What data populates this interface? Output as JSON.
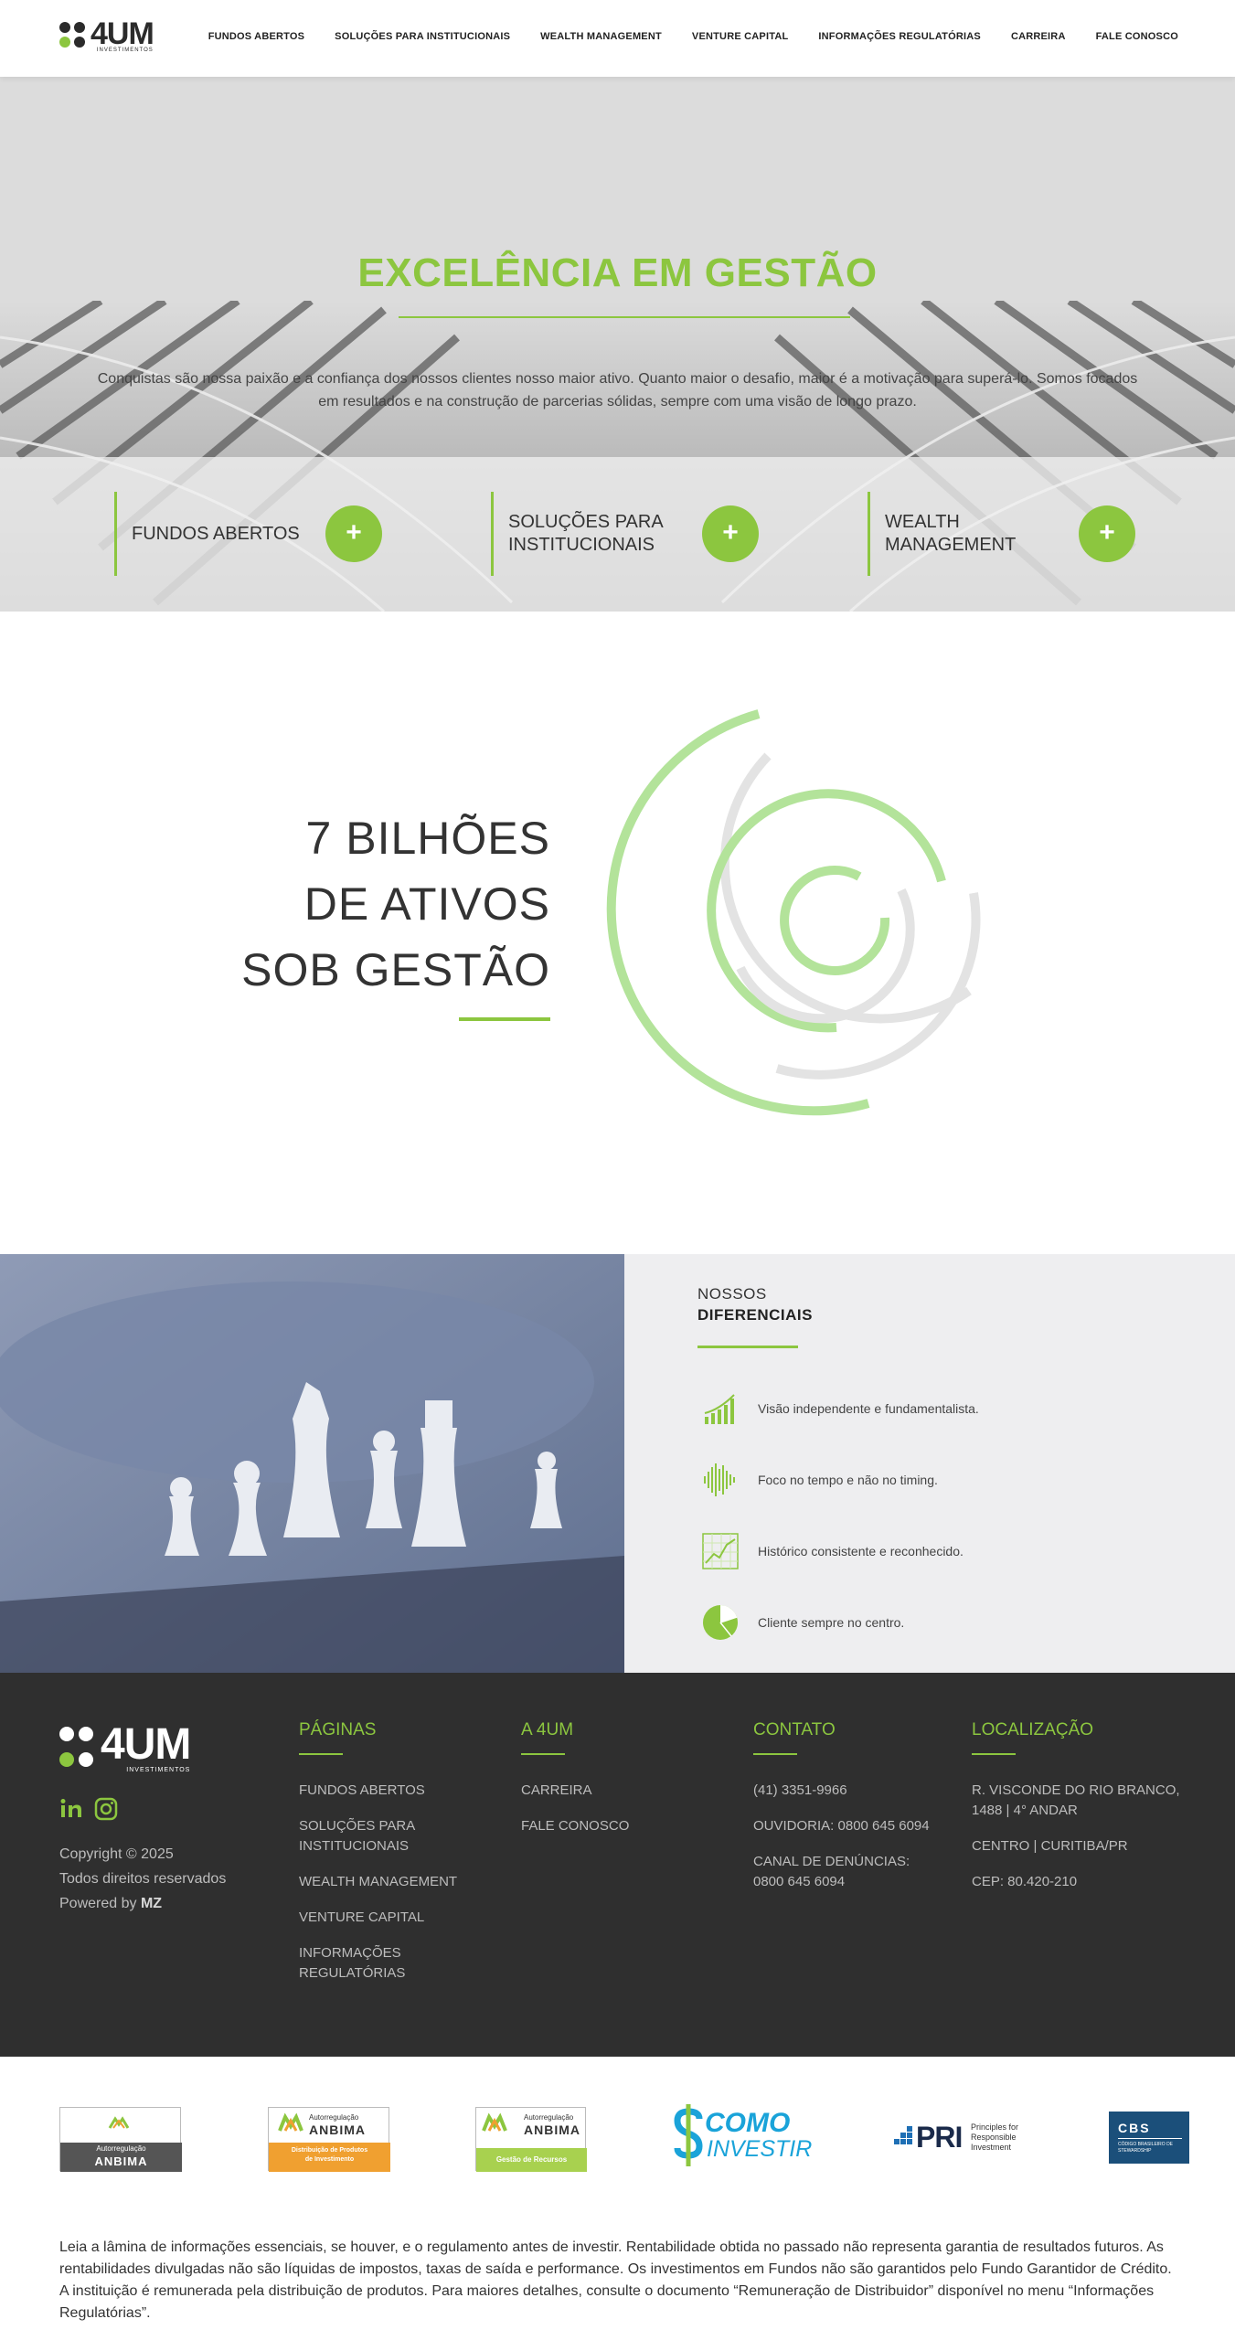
{
  "header": {
    "logo_text": "4UM",
    "logo_sub": "INVESTIMENTOS",
    "nav": [
      "FUNDOS ABERTOS",
      "SOLUÇÕES PARA INSTITUCIONAIS",
      "WEALTH MANAGEMENT",
      "VENTURE CAPITAL",
      "INFORMAÇÕES REGULATÓRIAS",
      "CARREIRA",
      "FALE CONOSCO"
    ]
  },
  "hero": {
    "title": "EXCELÊNCIA EM GESTÃO",
    "text": "Conquistas são nossa paixão e a confiança dos nossos clientes nosso maior ativo. Quanto maior o desafio, maior é a motivação para superá-lo. Somos focados em resultados e na construção de parcerias sólidas, sempre com uma visão de longo prazo.",
    "cards": [
      {
        "label": "FUNDOS ABERTOS",
        "icon": "plus-icon"
      },
      {
        "label": "SOLUÇÕES PARA INSTITUCIONAIS",
        "icon": "plus-icon"
      },
      {
        "label": "WEALTH MANAGEMENT",
        "icon": "plus-icon"
      }
    ],
    "plus": "+"
  },
  "stats": {
    "line1": "7 BILHÕES",
    "line2": "DE ATIVOS",
    "line3": "SOB GESTÃO"
  },
  "diferenciais": {
    "head1": "NOSSOS",
    "head2": "DIFERENCIAIS",
    "items": [
      {
        "text": "Visão independente e fundamentalista.",
        "icon": "bar-chart-icon"
      },
      {
        "text": "Foco no tempo e não no timing.",
        "icon": "waveform-icon"
      },
      {
        "text": "Histórico consistente e reconhecido.",
        "icon": "trend-chart-icon"
      },
      {
        "text": "Cliente sempre no centro.",
        "icon": "pie-chart-icon"
      }
    ]
  },
  "footer": {
    "logo_text": "4UM",
    "logo_sub": "INVESTIMENTOS",
    "copyright": "Copyright © 2025",
    "rights": "Todos direitos reservados",
    "powered_prefix": "Powered by",
    "powered_brand": "MZ",
    "columns": {
      "paginas": {
        "title": "PÁGINAS",
        "items": [
          "FUNDOS ABERTOS",
          "SOLUÇÕES PARA INSTITUCIONAIS",
          "WEALTH MANAGEMENT",
          "VENTURE CAPITAL",
          "INFORMAÇÕES REGULATÓRIAS"
        ]
      },
      "a4um": {
        "title": "A 4UM",
        "items": [
          "CARREIRA",
          "FALE CONOSCO"
        ]
      },
      "contato": {
        "title": "CONTATO",
        "items": [
          "(41) 3351-9966",
          "OUVIDORIA: 0800 645 6094",
          "CANAL DE DENÚNCIAS: 0800 645 6094"
        ]
      },
      "localizacao": {
        "title": "LOCALIZAÇÃO",
        "items": [
          "R. VISCONDE DO RIO BRANCO, 1488 | 4° ANDAR",
          "CENTRO | CURITIBA/PR",
          "CEP: 80.420-210"
        ]
      }
    }
  },
  "partners": {
    "anbima1": {
      "top": "Autorregulação",
      "name": "ANBIMA"
    },
    "anbima2": {
      "top": "Autorregulação",
      "name": "ANBIMA",
      "bottom": "Distribuição de Produtos de Investimento"
    },
    "anbima3": {
      "top": "Autorregulação",
      "name": "ANBIMA",
      "bottom": "Gestão de Recursos"
    },
    "como": {
      "line1": "COMO",
      "line2": "INVESTIR"
    },
    "pri": {
      "name": "PRI",
      "line1": "Principles for",
      "line2": "Responsible",
      "line3": "Investment"
    },
    "cbs": {
      "name": "CBS",
      "sub": "CÓDIGO BRASILEIRO DE STEWARDSHIP"
    }
  },
  "disclaimer": "Leia a lâmina de informações essenciais, se houver, e o regulamento antes de investir. Rentabilidade obtida no passado não representa garantia de resultados futuros. As rentabilidades divulgadas não são líquidas de impostos, taxas de saída e performance. Os investimentos em Fundos não são garantidos pelo Fundo Garantidor de Crédito. A instituição é remunerada pela distribuição de produtos. Para maiores detalhes, consulte o documento “Remuneração de Distribuidor” disponível no menu “Informações Regulatórias”.",
  "colors": {
    "accent": "#8cc63f",
    "dark": "#2f2f2f",
    "light": "#dcdcdc"
  }
}
